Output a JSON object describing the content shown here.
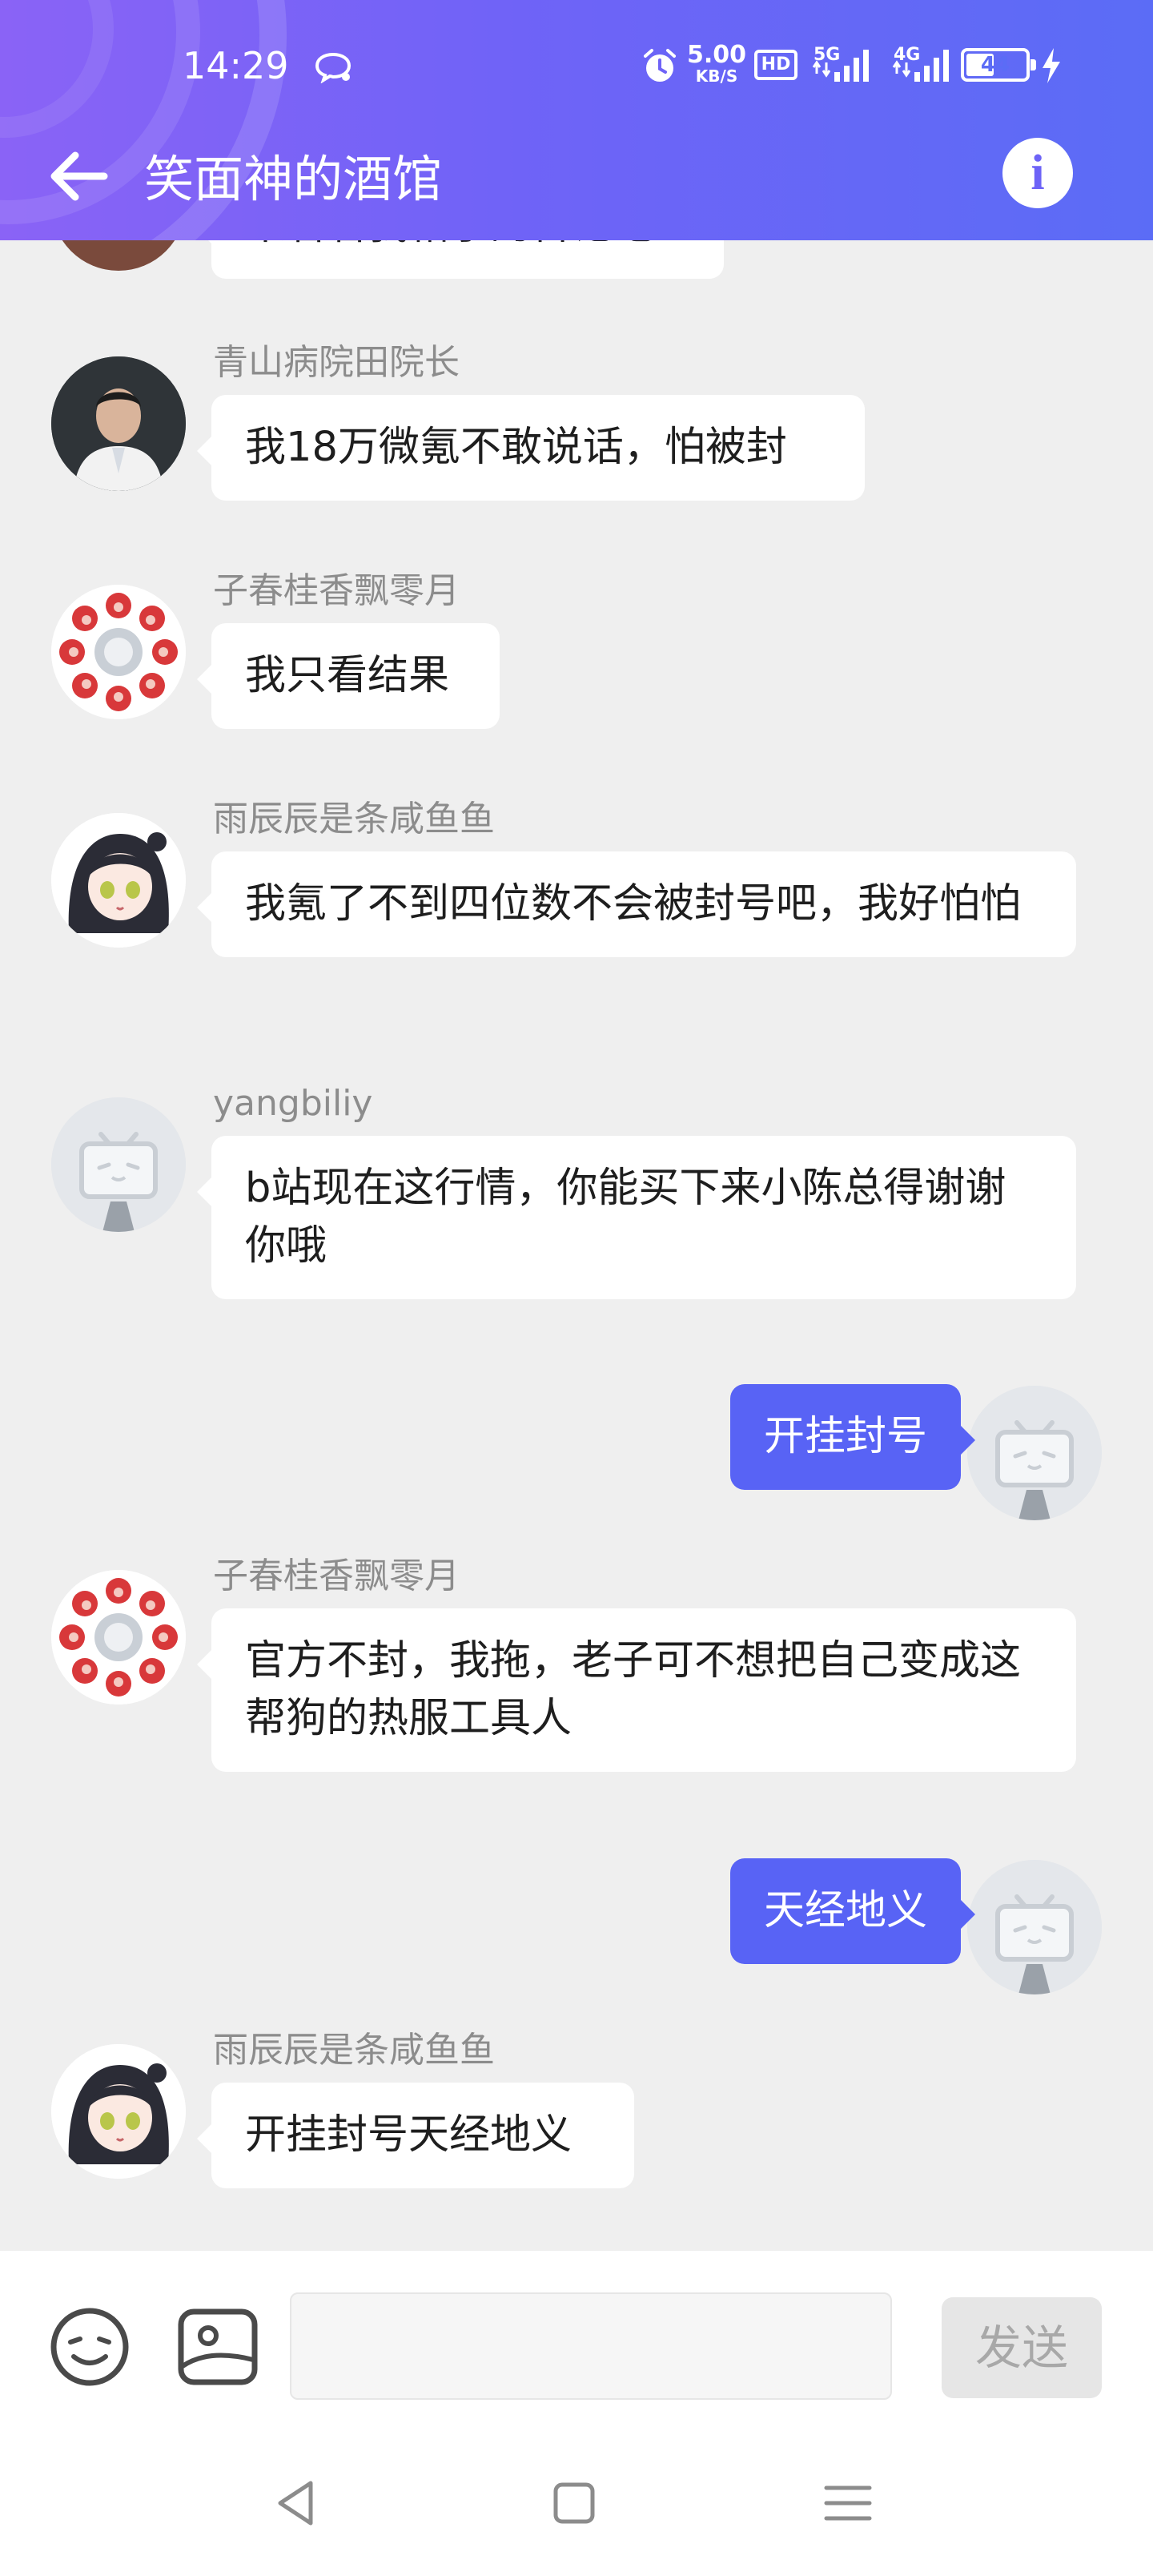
{
  "status_bar": {
    "time": "14:29",
    "net_speed_value": "5.00",
    "net_speed_unit": "KB/S",
    "hd_label": "HD",
    "net1": "5G",
    "net2": "4G",
    "battery": "44"
  },
  "header": {
    "title": "笑面神的酒馆",
    "back_icon": "arrow-left-icon",
    "info_icon": "info-icon",
    "gradient_start": "#8a63f6",
    "gradient_end": "#5b6cf6"
  },
  "messages": [
    {
      "side": "left",
      "sender": "",
      "text": "来看看我帖子的言论吧",
      "avatar": "avatar-partial"
    },
    {
      "side": "left",
      "sender": "青山病院田院长",
      "text": "我18万微氪不敢说话，怕被封",
      "avatar": "avatar-doctor"
    },
    {
      "side": "left",
      "sender": "子春桂香飘零月",
      "text": "我只看结果",
      "avatar": "avatar-red-flowers"
    },
    {
      "side": "left",
      "sender": "雨辰辰是条咸鱼鱼",
      "text": "我氪了不到四位数不会被封号吧，我好怕怕",
      "avatar": "avatar-anime-girl"
    },
    {
      "side": "left",
      "sender": "yangbiliy",
      "text": "b站现在这行情，你能买下来小陈总得谢谢你哦",
      "avatar": "avatar-default-tv"
    },
    {
      "side": "right",
      "text": "开挂封号",
      "avatar": "avatar-default-tv"
    },
    {
      "side": "left",
      "sender": "子春桂香飘零月",
      "text": "官方不封，我拖，老子可不想把自己变成这帮狗的热服工具人",
      "avatar": "avatar-red-flowers"
    },
    {
      "side": "right",
      "text": "天经地义",
      "avatar": "avatar-default-tv"
    },
    {
      "side": "left",
      "sender": "雨辰辰是条咸鱼鱼",
      "text": "开挂封号天经地义",
      "avatar": "avatar-anime-girl"
    }
  ],
  "input_bar": {
    "emoji_icon": "emoji-icon",
    "image_icon": "image-icon",
    "placeholder": "",
    "send_label": "发送"
  },
  "system_nav": {
    "back_icon": "nav-back-icon",
    "home_icon": "nav-home-icon",
    "menu_icon": "nav-menu-icon"
  },
  "colors": {
    "my_bubble": "#5863f5",
    "chat_background": "#efefef",
    "sender_name": "#8c8c8c"
  }
}
